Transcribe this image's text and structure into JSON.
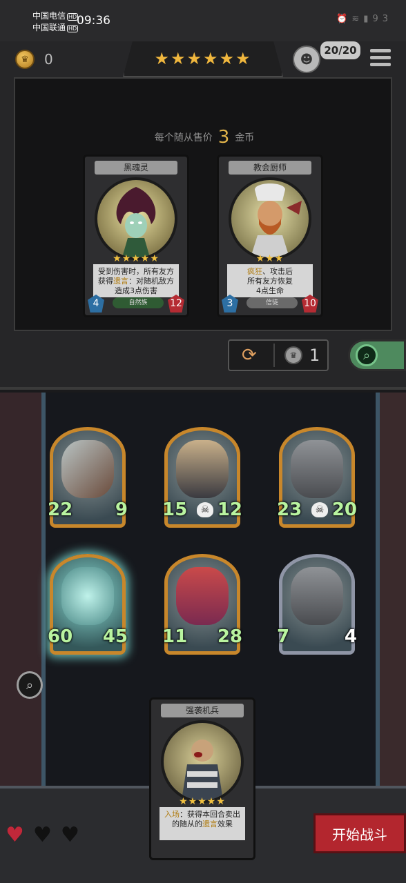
{
  "status_bar": {
    "carrier1": "中国电信",
    "carrier2": "中国联通",
    "hd_badge": "HD",
    "time": "09:36",
    "battery": "93"
  },
  "header": {
    "gold": "0",
    "tier_stars": "★★★★★★",
    "health_display": "20/20"
  },
  "shop": {
    "price_prefix": "每个随从售价",
    "price_value": "3",
    "price_suffix": "金币",
    "cards": [
      {
        "name": "黑魂灵",
        "stars": "★★★★★",
        "text_a": "受到伤害时，所有友方",
        "text_b_pre": "获得",
        "text_b_hl": "遗言",
        "text_b_post": "：对随机敌方",
        "text_c": "造成3点伤害",
        "attack": "4",
        "health": "12",
        "tribe": "自然族",
        "tribe_color": "#2f5b33"
      },
      {
        "name": "教会厨师",
        "stars": "★★★",
        "text_a_hl": "疯狂",
        "text_a_post": "、攻击后",
        "text_b": "所有友方恢复",
        "text_c": "4点生命",
        "attack": "3",
        "health": "10",
        "tribe": "信徒",
        "tribe_color": "#6a6a6a"
      }
    ],
    "reroll_cost": "1"
  },
  "board": {
    "minions": [
      {
        "attack": "22",
        "health": "9",
        "frame": "gold"
      },
      {
        "attack": "15",
        "health": "12",
        "frame": "gold",
        "deathrattle": true
      },
      {
        "attack": "23",
        "health": "20",
        "frame": "gold",
        "deathrattle": true
      },
      {
        "attack": "60",
        "health": "45",
        "frame": "gold",
        "glow": true
      },
      {
        "attack": "11",
        "health": "28",
        "frame": "gold"
      },
      {
        "attack": "7",
        "health": "4",
        "frame": "silver"
      }
    ]
  },
  "hand_card": {
    "name": "强袭机兵",
    "stars": "★★★★★",
    "text_a_hl": "入场",
    "text_a_post": "：获得本回合卖出",
    "text_b_pre": "的随从的",
    "text_b_hl": "遗言",
    "text_b_post": "效果"
  },
  "footer": {
    "lives_total": 3,
    "lives_remaining": 1,
    "start_label": "开始战斗"
  },
  "colors": {
    "gold_accent": "#e2b44a",
    "stat_green": "#b9f4a0",
    "start_red": "#b3262e",
    "frame_gold": "#c8872b"
  }
}
